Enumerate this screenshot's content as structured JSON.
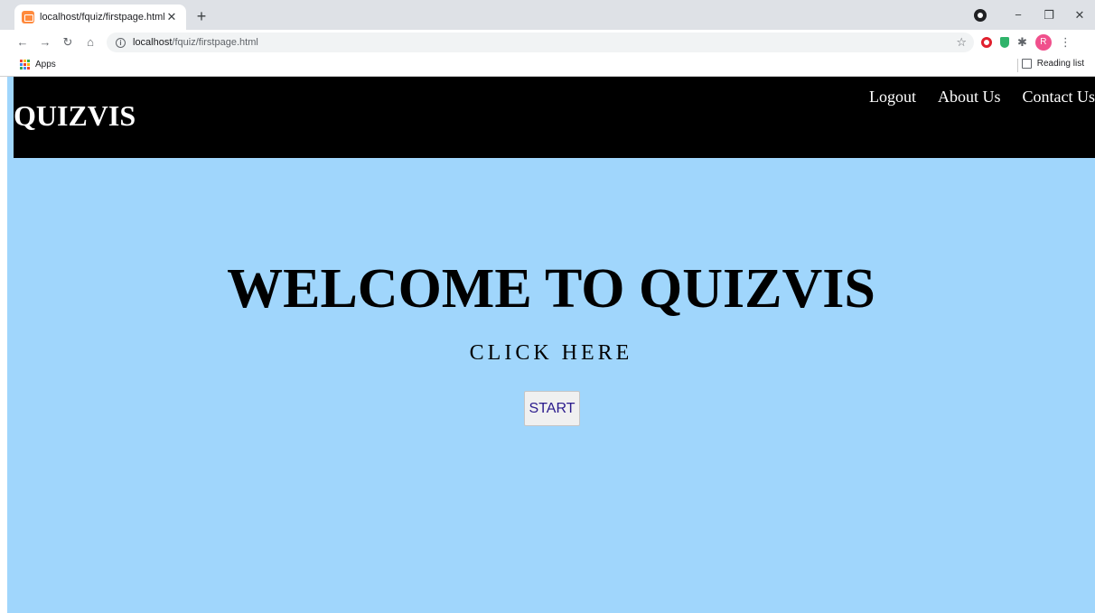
{
  "browser": {
    "tab_title": "localhost/fquiz/firstpage.html",
    "tab_close": "✕",
    "new_tab": "+",
    "url_host": "localhost",
    "url_path": "/fquiz/firstpage.html",
    "bookmarks_apps": "Apps",
    "reading_list": "Reading list",
    "profile_initial": "R",
    "window": {
      "minimize": "−",
      "restore": "❐",
      "close": "✕"
    },
    "nav": {
      "back": "←",
      "forward": "→",
      "reload": "↻",
      "home": "⌂"
    }
  },
  "site": {
    "brand": "QUIZVIS",
    "nav": [
      "Logout",
      "About Us",
      "Contact Us"
    ]
  },
  "hero": {
    "title": "WELCOME TO QUIZVIS",
    "subtitle": "CLICK HERE",
    "button": "START"
  },
  "colors": {
    "page_background": "#a0d6fc",
    "header_background": "#000000",
    "button_text": "#2a1a8c"
  }
}
